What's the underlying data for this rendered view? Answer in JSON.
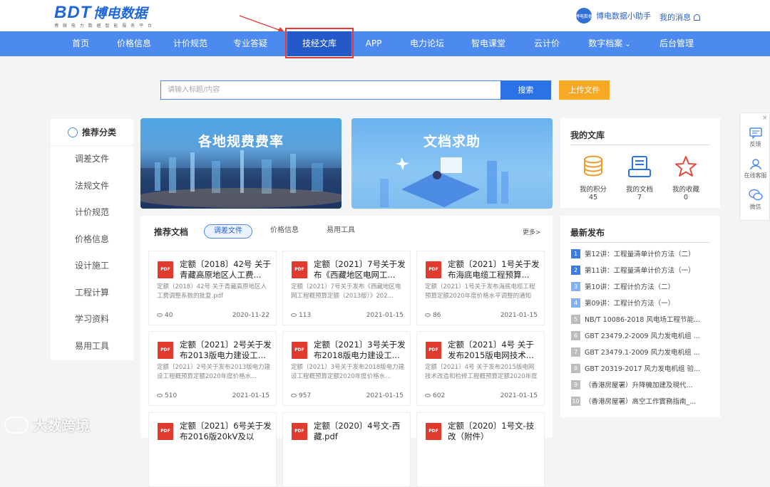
{
  "header": {
    "logo_bdt": "BDT",
    "logo_cn": "博电数据",
    "logo_sub": "博 微 电 力 数 据 智 能 服 务 平 台",
    "assistant_avatar": "博电数据",
    "assistant_label": "博电数据小助手",
    "messages_label": "我的消息"
  },
  "nav": {
    "items": [
      "首页",
      "价格信息",
      "计价规范",
      "专业答疑",
      "技经文库",
      "APP",
      "电力论坛",
      "智电课堂",
      "云计价",
      "数字档案",
      "后台管理"
    ],
    "active_index": 4,
    "dropdown_index": 9
  },
  "search": {
    "placeholder": "请输入标题/内容",
    "button": "搜索",
    "upload": "上传文件"
  },
  "categories": {
    "title": "推荐分类",
    "items": [
      "调差文件",
      "法规文件",
      "计价规范",
      "价格信息",
      "设计施工",
      "工程计算",
      "学习资料",
      "易用工具"
    ]
  },
  "banners": {
    "left_title": "各地规费费率",
    "right_title": "文档求助"
  },
  "recommended": {
    "title": "推荐文档",
    "tabs": [
      "调差文件",
      "价格信息",
      "易用工具"
    ],
    "active_tab": 0,
    "more": "更多>",
    "cards": [
      {
        "title": "定额〔2018〕42号 关于青藏高原地区人工费...",
        "desc": "定额〔2018〕42号 关于青藏高原地区人工费调整系数的批复.pdf",
        "views": "40",
        "date": "2020-11-22"
      },
      {
        "title": "定额〔2021〕7号关于发布《西藏地区电网工...",
        "desc": "定额〔2021〕7号关于发布《西藏地区电网工程概预算定额（2013版）》202...",
        "views": "113",
        "date": "2021-01-15"
      },
      {
        "title": "定额〔2021〕1号关于发布海底电缆工程预算...",
        "desc": "定额〔2021〕1号关于发布海底电缆工程预算定额2020年度价格水平调整的通知",
        "views": "86",
        "date": "2021-01-15"
      },
      {
        "title": "定额〔2021〕2号关于发布2013版电力建设工...",
        "desc": "定额〔2021〕2号关于发布2013版电力建设工程概预算定额2020年度价格水...",
        "views": "510",
        "date": "2021-01-15"
      },
      {
        "title": "定额〔2021〕3号关于发布2018版电力建设工...",
        "desc": "定额〔2021〕3号关于发布2018版电力建设工程概预算定额2020年度价格水...",
        "views": "957",
        "date": "2021-01-15"
      },
      {
        "title": "定额〔2021〕4号 关于发布2015版电网技术...",
        "desc": "定额〔2021〕4号 关于发布2015版电网技术改造和检修工程概预算定额2020年度价格水...",
        "views": "602",
        "date": "2021-01-15"
      },
      {
        "title": "定额〔2021〕6号关于发布2016版20kV及以",
        "desc": "",
        "views": "",
        "date": ""
      },
      {
        "title": "定额〔2020〕4号文-西藏.pdf",
        "desc": "",
        "views": "",
        "date": ""
      },
      {
        "title": "定额〔2020〕1号文-技改（附件）",
        "desc": "",
        "views": "",
        "date": ""
      }
    ]
  },
  "mylibrary": {
    "title": "我的文库",
    "stats": [
      {
        "label": "我的积分",
        "value": "45",
        "icon": "coins-icon",
        "color": "#f19a2a"
      },
      {
        "label": "我的文档",
        "value": "7",
        "icon": "document-list-icon",
        "color": "#2b72e6"
      },
      {
        "label": "我的收藏",
        "value": "0",
        "icon": "star-icon",
        "color": "#e64a3c"
      }
    ]
  },
  "latest": {
    "title": "最新发布",
    "items": [
      {
        "n": "1",
        "text": "第12讲：工程量清单计价方法（二）"
      },
      {
        "n": "2",
        "text": "第11讲：工程量清单计价方法（一）"
      },
      {
        "n": "3",
        "text": "第10讲：工程计价方法（二）"
      },
      {
        "n": "4",
        "text": "第09讲：工程计价方法（一）"
      },
      {
        "n": "5",
        "text": "NB/T 10086-2018 风电场工程节能..."
      },
      {
        "n": "6",
        "text": "GBT 23479.2-2009 风力发电机组 ..."
      },
      {
        "n": "7",
        "text": "GBT 23479.1-2009 风力发电机组 ..."
      },
      {
        "n": "8",
        "text": "GBT 20319-2017 风力发电机组 验..."
      },
      {
        "n": "9",
        "text": "（香港房屋署）升降機加建及現代..."
      },
      {
        "n": "10",
        "text": "（香港房屋署）高空工作實務指南_..."
      }
    ],
    "colors": {
      "top": "#3b7be8",
      "mid": "#7fb1f4",
      "rest": "#bdbdbd"
    }
  },
  "sidewidget": {
    "close": "×",
    "items": [
      "反馈",
      "在线客服",
      "微信"
    ]
  },
  "watermark": "大数跨境"
}
